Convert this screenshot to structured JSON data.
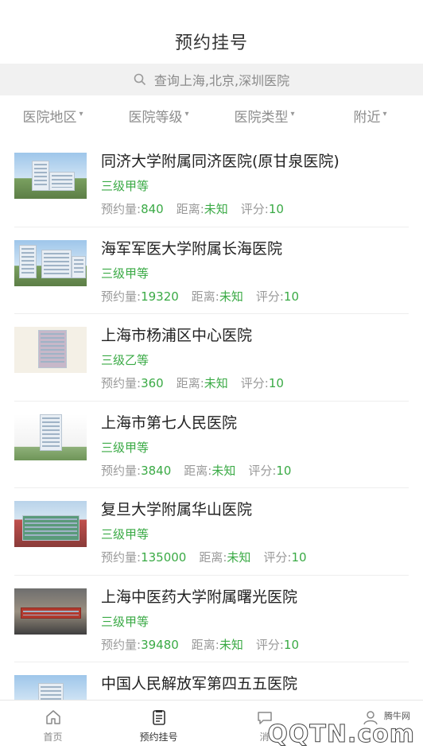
{
  "header": {
    "title": "预约挂号"
  },
  "search": {
    "placeholder": "查询上海,北京,深圳医院",
    "icon": "search-icon"
  },
  "filters": [
    {
      "label": "医院地区"
    },
    {
      "label": "医院等级"
    },
    {
      "label": "医院类型"
    },
    {
      "label": "附近"
    }
  ],
  "stat_labels": {
    "appointments": "预约量:",
    "distance": "距离:",
    "score": "评分:"
  },
  "hospitals": [
    {
      "name": "同济大学附属同济医院(原甘泉医院)",
      "level": "三级甲等",
      "appointments": "840",
      "distance": "未知",
      "score": "10"
    },
    {
      "name": "海军军医大学附属长海医院",
      "level": "三级甲等",
      "appointments": "19320",
      "distance": "未知",
      "score": "10"
    },
    {
      "name": "上海市杨浦区中心医院",
      "level": "三级乙等",
      "appointments": "360",
      "distance": "未知",
      "score": "10"
    },
    {
      "name": "上海市第七人民医院",
      "level": "三级甲等",
      "appointments": "3840",
      "distance": "未知",
      "score": "10"
    },
    {
      "name": "复旦大学附属华山医院",
      "level": "三级甲等",
      "appointments": "135000",
      "distance": "未知",
      "score": "10"
    },
    {
      "name": "上海中医药大学附属曙光医院",
      "level": "三级甲等",
      "appointments": "39480",
      "distance": "未知",
      "score": "10"
    },
    {
      "name": "中国人民解放军第四五五医院",
      "level": "",
      "appointments": "",
      "distance": "",
      "score": ""
    }
  ],
  "tabbar": [
    {
      "label": "首页",
      "icon": "home-icon"
    },
    {
      "label": "预约挂号",
      "icon": "register-icon"
    },
    {
      "label": "消",
      "icon": "message-icon"
    },
    {
      "label": "",
      "icon": "profile-icon"
    }
  ],
  "watermark": {
    "small": "腾牛网",
    "big": "QQTN.com"
  },
  "colors": {
    "accent_green": "#3aaa45",
    "muted_gray": "#9a9a9a",
    "search_bg": "#f1f1f1"
  }
}
